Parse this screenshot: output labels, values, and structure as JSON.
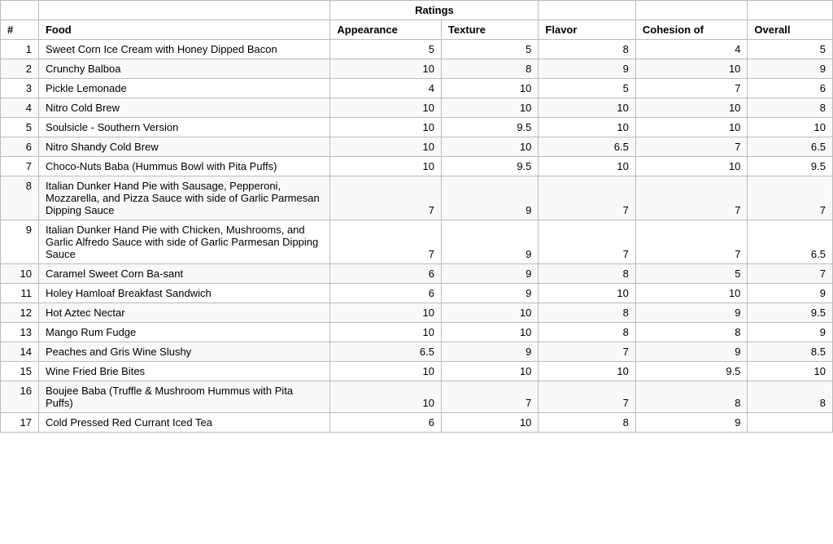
{
  "table": {
    "group_header": "Ratings",
    "columns": {
      "num": "#",
      "food": "Food",
      "appearance": "Appearance",
      "texture": "Texture",
      "flavor": "Flavor",
      "cohesion": "Cohesion of",
      "overall": "Overall"
    },
    "rows": [
      {
        "num": "1",
        "food": "Sweet Corn Ice Cream with Honey Dipped Bacon",
        "appearance": "5",
        "texture": "5",
        "flavor": "8",
        "cohesion": "4",
        "overall": "5"
      },
      {
        "num": "2",
        "food": "Crunchy Balboa",
        "appearance": "10",
        "texture": "8",
        "flavor": "9",
        "cohesion": "10",
        "overall": "9"
      },
      {
        "num": "3",
        "food": "Pickle Lemonade",
        "appearance": "4",
        "texture": "10",
        "flavor": "5",
        "cohesion": "7",
        "overall": "6"
      },
      {
        "num": "4",
        "food": "Nitro Cold Brew",
        "appearance": "10",
        "texture": "10",
        "flavor": "10",
        "cohesion": "10",
        "overall": "8"
      },
      {
        "num": "5",
        "food": "Soulsicle - Southern Version",
        "appearance": "10",
        "texture": "9.5",
        "flavor": "10",
        "cohesion": "10",
        "overall": "10"
      },
      {
        "num": "6",
        "food": "Nitro Shandy Cold Brew",
        "appearance": "10",
        "texture": "10",
        "flavor": "6.5",
        "cohesion": "7",
        "overall": "6.5"
      },
      {
        "num": "7",
        "food": "Choco-Nuts Baba (Hummus Bowl with Pita Puffs)",
        "appearance": "10",
        "texture": "9.5",
        "flavor": "10",
        "cohesion": "10",
        "overall": "9.5"
      },
      {
        "num": "8",
        "food": "Italian Dunker Hand Pie with Sausage, Pepperoni, Mozzarella, and Pizza Sauce with side of Garlic Parmesan Dipping Sauce",
        "appearance": "7",
        "texture": "9",
        "flavor": "7",
        "cohesion": "7",
        "overall": "7"
      },
      {
        "num": "9",
        "food": "Italian Dunker Hand Pie with Chicken, Mushrooms, and Garlic Alfredo Sauce with side of Garlic Parmesan Dipping Sauce",
        "appearance": "7",
        "texture": "9",
        "flavor": "7",
        "cohesion": "7",
        "overall": "6.5"
      },
      {
        "num": "10",
        "food": "Caramel Sweet Corn Ba-sant",
        "appearance": "6",
        "texture": "9",
        "flavor": "8",
        "cohesion": "5",
        "overall": "7"
      },
      {
        "num": "11",
        "food": "Holey Hamloaf Breakfast Sandwich",
        "appearance": "6",
        "texture": "9",
        "flavor": "10",
        "cohesion": "10",
        "overall": "9"
      },
      {
        "num": "12",
        "food": "Hot Aztec Nectar",
        "appearance": "10",
        "texture": "10",
        "flavor": "8",
        "cohesion": "9",
        "overall": "9.5"
      },
      {
        "num": "13",
        "food": "Mango Rum Fudge",
        "appearance": "10",
        "texture": "10",
        "flavor": "8",
        "cohesion": "8",
        "overall": "9"
      },
      {
        "num": "14",
        "food": "Peaches and Gris Wine Slushy",
        "appearance": "6.5",
        "texture": "9",
        "flavor": "7",
        "cohesion": "9",
        "overall": "8.5"
      },
      {
        "num": "15",
        "food": "Wine Fried Brie Bites",
        "appearance": "10",
        "texture": "10",
        "flavor": "10",
        "cohesion": "9.5",
        "overall": "10"
      },
      {
        "num": "16",
        "food": "Boujee Baba (Truffle & Mushroom Hummus with Pita Puffs)",
        "appearance": "10",
        "texture": "7",
        "flavor": "7",
        "cohesion": "8",
        "overall": "8"
      },
      {
        "num": "17",
        "food": "Cold Pressed Red Currant Iced Tea",
        "appearance": "6",
        "texture": "10",
        "flavor": "8",
        "cohesion": "9",
        "overall": ""
      }
    ]
  }
}
